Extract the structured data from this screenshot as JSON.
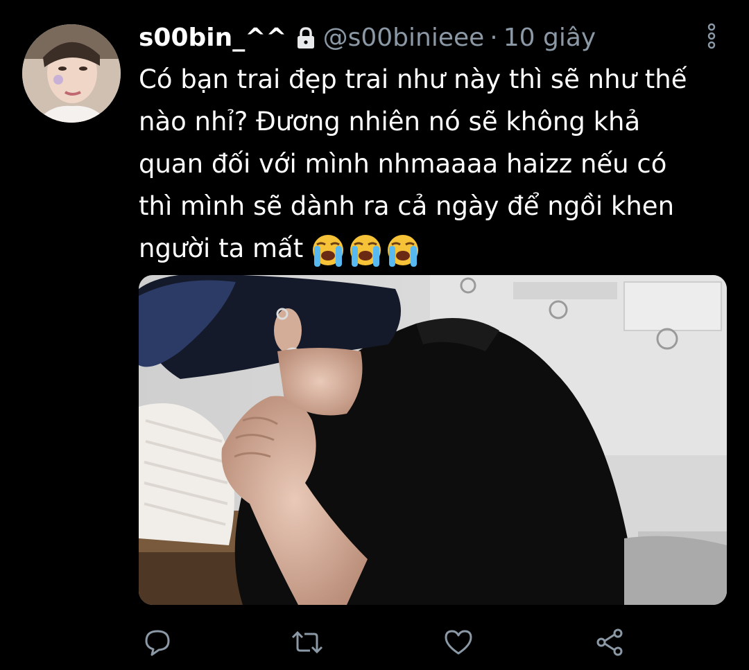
{
  "tweet": {
    "display_name": "s00bin_^^",
    "handle": "@s00binieee",
    "separator": "·",
    "time": "10 giây",
    "text_lines": [
      "Có bạn trai đẹp trai như này thì sẽ như thế",
      "nào nhỉ? Đương nhiên nó sẽ không khả",
      "quan đối với mình nhmaaaa haizz nếu có",
      "thì mình sẽ dành ra cả ngày để ngồi khen",
      "người ta mất"
    ],
    "emoji": [
      "loudly-crying-face",
      "loudly-crying-face",
      "loudly-crying-face"
    ]
  },
  "icons": {
    "lock": "lock-icon",
    "more": "more-vertical-icon",
    "reply": "reply-icon",
    "retweet": "retweet-icon",
    "like": "heart-icon",
    "share": "share-icon"
  },
  "colors": {
    "background": "#000000",
    "text": "#ffffff",
    "secondary": "#8b98a5",
    "icon": "#8b98a5"
  }
}
